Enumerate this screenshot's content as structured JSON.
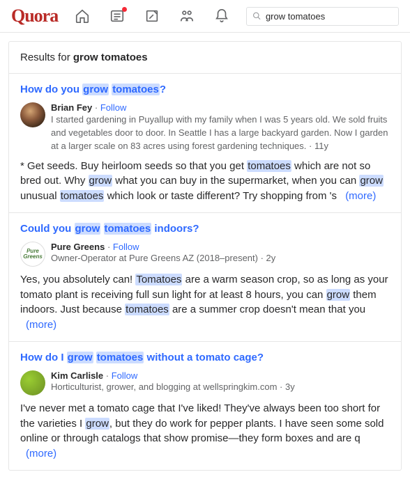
{
  "brand": "Quora",
  "search": {
    "value": "grow tomatoes"
  },
  "results_label": "Results for ",
  "results_query": "grow tomatoes",
  "more_label": "(more)",
  "results": [
    {
      "title_parts": [
        {
          "t": "How do you ",
          "hl": false
        },
        {
          "t": "grow",
          "hl": true
        },
        {
          "t": " ",
          "hl": false
        },
        {
          "t": "tomatoes",
          "hl": true
        },
        {
          "t": "?",
          "hl": false
        }
      ],
      "author": "Brian Fey",
      "follow": "Follow",
      "bio": "I started gardening in Puyallup with my family when I was 5 years old. We sold fruits and vegetables door to door. In Seattle I has a large backyard garden. Now I garden at a larger scale on 83 acres using forest gardening techniques.",
      "age": "11y",
      "avatar_class": "brian",
      "body_parts": [
        {
          "t": "* Get seeds. Buy heirloom seeds so that you get ",
          "hl": false
        },
        {
          "t": "tomatoes",
          "hl": true
        },
        {
          "t": " which are not so bred out. Why ",
          "hl": false
        },
        {
          "t": "grow",
          "hl": true
        },
        {
          "t": " what you can buy in the supermarket, when you can ",
          "hl": false
        },
        {
          "t": "grow",
          "hl": true
        },
        {
          "t": " unusual ",
          "hl": false
        },
        {
          "t": "tomatoes",
          "hl": true
        },
        {
          "t": " which look or taste different? Try shopping from 's",
          "hl": false
        }
      ]
    },
    {
      "title_parts": [
        {
          "t": "Could you ",
          "hl": false
        },
        {
          "t": "grow",
          "hl": true
        },
        {
          "t": " ",
          "hl": false
        },
        {
          "t": "tomatoes",
          "hl": true
        },
        {
          "t": " indoors?",
          "hl": false
        }
      ],
      "author": "Pure Greens",
      "follow": "Follow",
      "credential": "Owner-Operator at Pure Greens AZ (2018–present)",
      "age": "2y",
      "avatar_class": "pure",
      "avatar_text": "Pure Greens",
      "body_parts": [
        {
          "t": "Yes, you absolutely can! ",
          "hl": false
        },
        {
          "t": "Tomatoes",
          "hl": true
        },
        {
          "t": " are a warm season crop, so as long as your tomato plant is receiving full sun light for at least 8 hours, you can ",
          "hl": false
        },
        {
          "t": "grow",
          "hl": true
        },
        {
          "t": " them indoors. Just because ",
          "hl": false
        },
        {
          "t": "tomatoes",
          "hl": true
        },
        {
          "t": " are a summer crop doesn't mean that you",
          "hl": false
        }
      ]
    },
    {
      "title_parts": [
        {
          "t": "How do I ",
          "hl": false
        },
        {
          "t": "grow",
          "hl": true
        },
        {
          "t": " ",
          "hl": false
        },
        {
          "t": "tomatoes",
          "hl": true
        },
        {
          "t": " without a tomato cage?",
          "hl": false
        }
      ],
      "author": "Kim Carlisle",
      "follow": "Follow",
      "credential": "Horticulturist, grower, and blogging at wellspringkim.com",
      "age": "3y",
      "avatar_class": "kim",
      "body_parts": [
        {
          "t": "I've never met a tomato cage that I've liked! They've always been too short for the varieties I ",
          "hl": false
        },
        {
          "t": "grow",
          "hl": true
        },
        {
          "t": ", but they do work for pepper plants. I have seen some sold online or through catalogs that show promise—they form boxes and are q",
          "hl": false
        }
      ]
    }
  ]
}
